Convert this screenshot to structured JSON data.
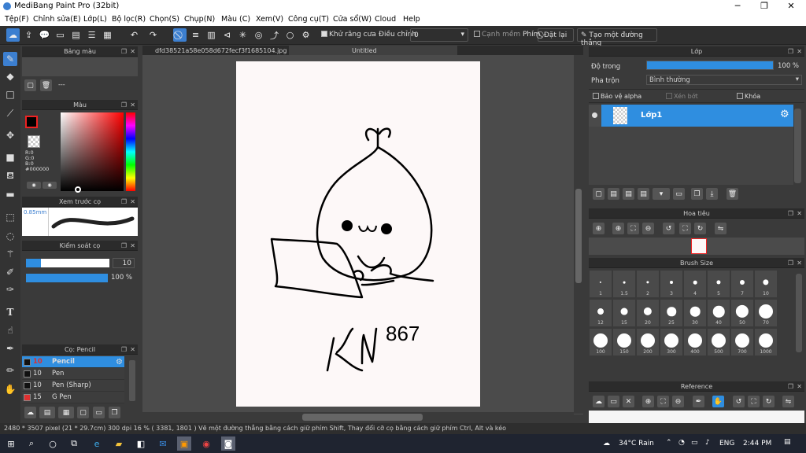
{
  "window": {
    "title": "MediBang Paint Pro (32bit)",
    "controls": [
      "─",
      "❐",
      "✕"
    ]
  },
  "menu": [
    "Tệp(F)",
    "Chỉnh sửa(E)",
    "Lớp(L)",
    "Bộ lọc(R)",
    "Chọn(S)",
    "Chụp(N)",
    "Màu (C)",
    "Xem(V)",
    "Công cụ(T)",
    "Cửa sổ(W)",
    "Cloud",
    "Help"
  ],
  "toolbar": {
    "antialias_label": "Khử răng cưa",
    "adjust_label": "Điều chỉnh",
    "adjust_value": "0",
    "smooth_label": "Cạnh mềm",
    "key_label": "Phím",
    "reset_label": "Đặt lại",
    "line_label": "Tạo một đường thẳng"
  },
  "tabs": {
    "file1": "dfd38521a58e058d672fecf3f1685104.jpg",
    "file2": "Untitled"
  },
  "panels": {
    "palette": {
      "title": "Bảng màu",
      "value": "---"
    },
    "color": {
      "title": "Màu",
      "r": "R:0",
      "g": "G:0",
      "b": "B:0",
      "hex": "#000000",
      "fg_color": "#000000"
    },
    "brush_preview": {
      "title": "Xem trước cọ",
      "size": "0.85mm"
    },
    "brush_control": {
      "title": "Kiểm soát cọ",
      "size": "10",
      "opacity": "100 %"
    },
    "brush_list": {
      "title": "Cọ: Pencil",
      "items": [
        {
          "size": "10",
          "name": "Pencil",
          "color": "#111111"
        },
        {
          "size": "10",
          "name": "Pen",
          "color": "#111111"
        },
        {
          "size": "10",
          "name": "Pen (Sharp)",
          "color": "#111111"
        },
        {
          "size": "15",
          "name": "G Pen",
          "color": "#e03030"
        }
      ]
    },
    "layer": {
      "title": "Lớp",
      "opacity_label": "Độ trong",
      "opacity_value": "100 %",
      "blend_label": "Pha trộn",
      "blend_value": "Bình thường",
      "protect_alpha": "Bảo vệ alpha",
      "clip": "Xén bớt",
      "lock": "Khóa",
      "layer_name": "Lớp1"
    },
    "navigator": {
      "title": "Hoa tiêu"
    },
    "brush_size": {
      "title": "Brush Size",
      "sizes": [
        "1",
        "1.5",
        "2",
        "3",
        "4",
        "5",
        "7",
        "10",
        "12",
        "15",
        "20",
        "25",
        "30",
        "40",
        "50",
        "70",
        "100",
        "150",
        "200",
        "300",
        "400",
        "500",
        "700",
        "1000"
      ]
    },
    "reference": {
      "title": "Reference"
    }
  },
  "status": {
    "text": "2480 * 3507 pixel  (21 * 29.7cm)  300 dpi  16 %  ( 3381, 1801 )  Vẽ một đường thẳng bằng cách giữ phím Shift, Thay đổi cỡ cọ bằng cách giữ phím Ctrl, Alt và kéo"
  },
  "taskbar": {
    "weather": "34°C  Rain",
    "lang": "ENG",
    "time": "2:44 PM"
  },
  "drawing": {
    "text1": "KN",
    "text2": "867"
  }
}
